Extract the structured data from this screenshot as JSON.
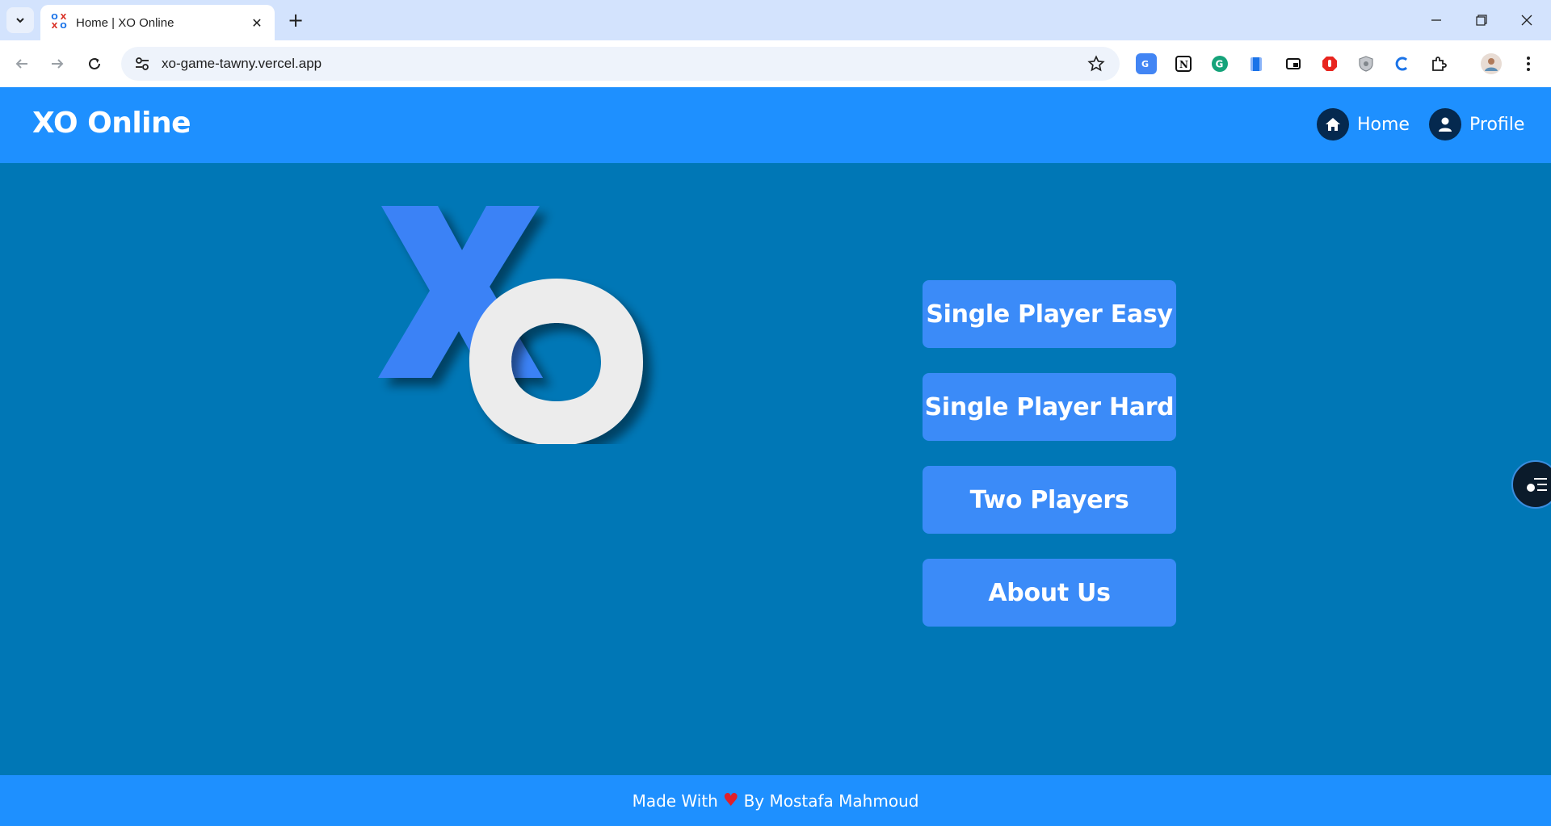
{
  "browser": {
    "tab_title": "Home | XO Online",
    "favicon_text": [
      "O",
      "X",
      "X",
      "O"
    ],
    "close_glyph": "✕",
    "new_tab_glyph": "+",
    "url": "xo-game-tawny.vercel.app"
  },
  "header": {
    "brand": "XO Online",
    "nav": [
      {
        "label": "Home",
        "icon": "home-icon"
      },
      {
        "label": "Profile",
        "icon": "user-icon"
      }
    ]
  },
  "hero": {
    "logo_letters": {
      "x": "X",
      "o": "O"
    },
    "logo_colors": {
      "x": "#3b82f6",
      "o": "#ececec"
    }
  },
  "menu": {
    "buttons": [
      {
        "label": "Single Player Easy"
      },
      {
        "label": "Single Player Hard"
      },
      {
        "label": "Two Players"
      },
      {
        "label": "About Us"
      }
    ]
  },
  "footer": {
    "made_with": "Made With",
    "heart": "♥",
    "by": "By Mostafa Mahmoud"
  },
  "colors": {
    "header_bg": "#1e90ff",
    "main_bg": "#0077b6",
    "button_bg": "#3b8bf8",
    "nav_icon_bg": "#05294f",
    "heart": "#e0202b"
  }
}
